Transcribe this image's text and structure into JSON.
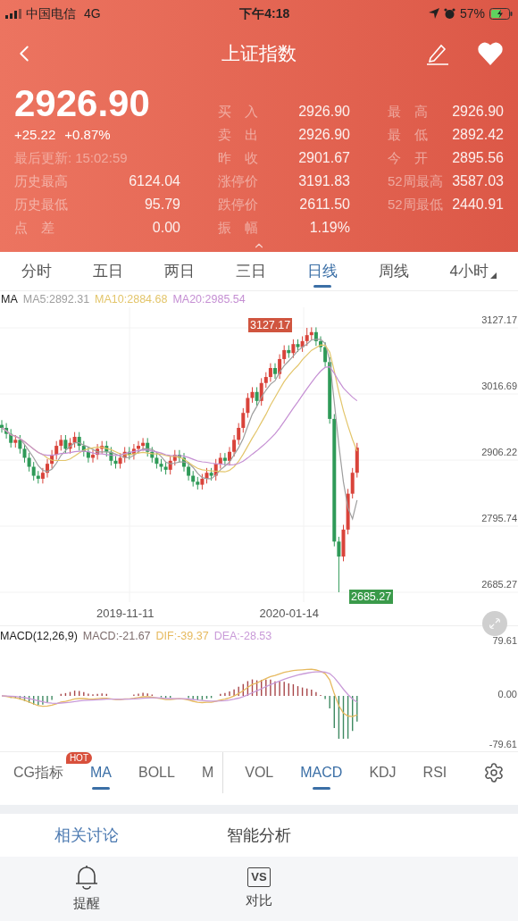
{
  "status_bar": {
    "carrier": "中国电信",
    "network": "4G",
    "time": "下午4:18",
    "battery": "57%"
  },
  "nav": {
    "title": "上证指数"
  },
  "quote": {
    "price": "2926.90",
    "change": "+25.22",
    "change_pct": "+0.87%",
    "update_label": "最后更新:",
    "update_time": "15:02:59",
    "left_stats": [
      {
        "label": "历史最高",
        "value": "6124.04"
      },
      {
        "label": "历史最低",
        "value": "95.79"
      },
      {
        "label": "点　差",
        "value": "0.00"
      }
    ],
    "middle_stats": [
      {
        "label": "买　入",
        "value": "2926.90"
      },
      {
        "label": "卖　出",
        "value": "2926.90"
      },
      {
        "label": "昨　收",
        "value": "2901.67"
      },
      {
        "label": "涨停价",
        "value": "3191.83"
      },
      {
        "label": "跌停价",
        "value": "2611.50"
      },
      {
        "label": "振　幅",
        "value": "1.19%"
      }
    ],
    "right_stats": [
      {
        "label": "最　高",
        "value": "2926.90"
      },
      {
        "label": "最　低",
        "value": "2892.42"
      },
      {
        "label": "今　开",
        "value": "2895.56"
      },
      {
        "label": "52周最高",
        "value": "3587.03"
      },
      {
        "label": "52周最低",
        "value": "2440.91"
      }
    ]
  },
  "period_tabs": [
    {
      "label": "分时",
      "selected": false,
      "kind": "plain"
    },
    {
      "label": "五日",
      "selected": false,
      "kind": "plain"
    },
    {
      "label": "两日",
      "selected": false,
      "kind": "plain"
    },
    {
      "label": "三日",
      "selected": false,
      "kind": "plain"
    },
    {
      "label": "日线",
      "selected": true,
      "kind": "plain"
    },
    {
      "label": "周线",
      "selected": false,
      "kind": "plain"
    },
    {
      "label": "4小时",
      "selected": false,
      "kind": "dropdown"
    }
  ],
  "ma_legend": {
    "title": "MA",
    "items": [
      {
        "label": "MA5:2892.31",
        "color": "#9e9e9e"
      },
      {
        "label": "MA10:2884.68",
        "color": "#e3c56a"
      },
      {
        "label": "MA20:2985.54",
        "color": "#c58fd3"
      }
    ]
  },
  "price_chart": {
    "max_label": "3127.17",
    "min_label": "2685.27",
    "y_labels": [
      "3127.17",
      "3016.69",
      "2906.22",
      "2795.74",
      "2685.27"
    ],
    "x_labels": [
      "2019-11-11",
      "2020-01-14"
    ]
  },
  "macd": {
    "title": "MACD(12,26,9)",
    "items": [
      {
        "label": "MACD:-21.67",
        "color": "#7d6d6d"
      },
      {
        "label": "DIF:-39.37",
        "color": "#e6b95e"
      },
      {
        "label": "DEA:-28.53",
        "color": "#c99ad8"
      }
    ],
    "y_labels": [
      "79.61",
      "0.00",
      "-79.61"
    ]
  },
  "indicator_groups": [
    [
      {
        "label": "CG指标",
        "selected": false,
        "badge": "HOT"
      },
      {
        "label": "MA",
        "selected": true
      },
      {
        "label": "BOLL",
        "selected": false
      },
      {
        "label": "M",
        "selected": false
      }
    ],
    [
      {
        "label": "VOL",
        "selected": false
      },
      {
        "label": "MACD",
        "selected": true
      },
      {
        "label": "KDJ",
        "selected": false
      },
      {
        "label": "RSI",
        "selected": false
      }
    ]
  ],
  "section_tabs": [
    {
      "label": "相关讨论",
      "selected": true
    },
    {
      "label": "智能分析",
      "selected": false
    }
  ],
  "toolbar": [
    {
      "label": "提醒",
      "kind": "bell"
    },
    {
      "label": "对比",
      "kind": "vs",
      "icon_text": "VS"
    }
  ]
}
